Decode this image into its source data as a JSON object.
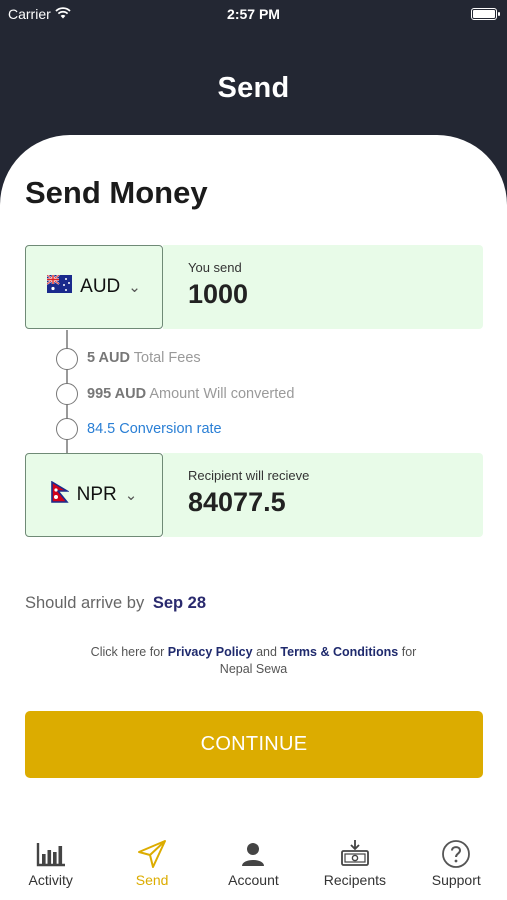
{
  "status_bar": {
    "carrier": "Carrier",
    "time": "2:57 PM"
  },
  "nav": {
    "title": "Send"
  },
  "page": {
    "title": "Send Money"
  },
  "send": {
    "currency": "AUD",
    "label": "You send",
    "amount": "1000"
  },
  "breakdown": {
    "fees_amount": "5 AUD",
    "fees_label": "Total Fees",
    "converted_amount": "995 AUD",
    "converted_label": "Amount Will converted",
    "rate_text": "84.5 Conversion rate"
  },
  "receive": {
    "currency": "NPR",
    "label": "Recipient will recieve",
    "amount": "84077.5"
  },
  "arrival": {
    "label": "Should arrive by",
    "date": "Sep 28"
  },
  "policy": {
    "prefix": "Click here for",
    "privacy": "Privacy Policy",
    "and": "and",
    "terms": "Terms & Conditions",
    "suffix": "for",
    "brand": "Nepal Sewa"
  },
  "continue_button": {
    "label": "CONTINUE"
  },
  "tabs": [
    {
      "label": "Activity",
      "icon": "bar-chart-icon",
      "active": false
    },
    {
      "label": "Send",
      "icon": "paper-plane-icon",
      "active": true
    },
    {
      "label": "Account",
      "icon": "person-icon",
      "active": false
    },
    {
      "label": "Recipents",
      "icon": "money-download-icon",
      "active": false
    },
    {
      "label": "Support",
      "icon": "help-circle-icon",
      "active": false
    }
  ],
  "colors": {
    "header": "#232733",
    "accent": "#dcac00",
    "panel": "#e8fbe8",
    "link": "#2a7fd5"
  }
}
